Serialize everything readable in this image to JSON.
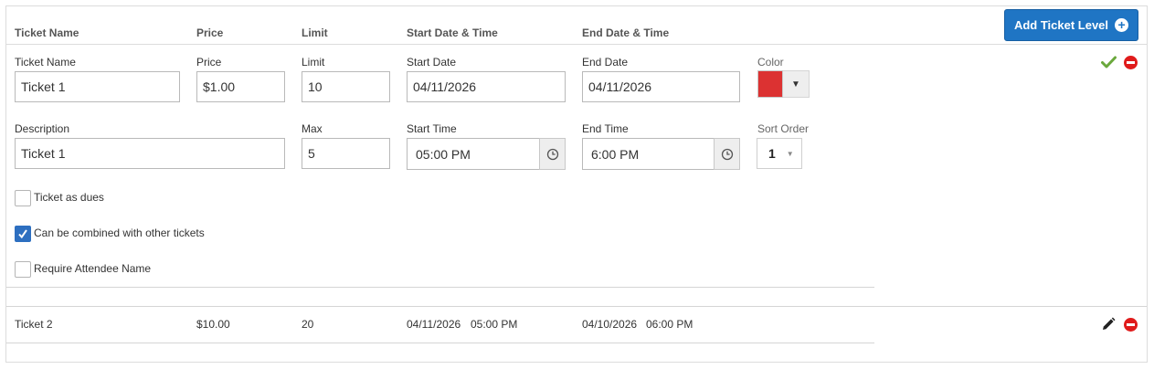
{
  "header": {
    "col_ticket_name": "Ticket Name",
    "col_price": "Price",
    "col_limit": "Limit",
    "col_start": "Start Date & Time",
    "col_end": "End Date & Time",
    "add_button_label": "Add Ticket Level"
  },
  "edit_form": {
    "labels": {
      "ticket_name": "Ticket Name",
      "price": "Price",
      "limit": "Limit",
      "start_date": "Start Date",
      "end_date": "End Date",
      "color": "Color",
      "description": "Description",
      "max": "Max",
      "start_time": "Start Time",
      "end_time": "End Time",
      "sort_order": "Sort Order"
    },
    "values": {
      "ticket_name": "Ticket 1",
      "price": "$1.00",
      "limit": "10",
      "start_date": "04/11/2026",
      "end_date": "04/11/2026",
      "description": "Ticket 1",
      "max": "5",
      "start_time": "05:00 PM",
      "end_time": "6:00 PM",
      "sort_order": "1"
    },
    "color_value": "#dc3232",
    "checkboxes": [
      {
        "label": "Ticket as dues",
        "checked": false
      },
      {
        "label": "Can be combined with other tickets",
        "checked": true
      },
      {
        "label": "Require Attendee Name",
        "checked": false
      }
    ]
  },
  "tickets": [
    {
      "name": "Ticket 2",
      "price": "$10.00",
      "limit": "20",
      "start_date": "04/11/2026",
      "start_time": "05:00 PM",
      "end_date": "04/10/2026",
      "end_time": "06:00 PM"
    }
  ],
  "colors": {
    "accent": "#1f75c4",
    "confirm": "#6aa83c",
    "delete": "#e01b1b"
  }
}
